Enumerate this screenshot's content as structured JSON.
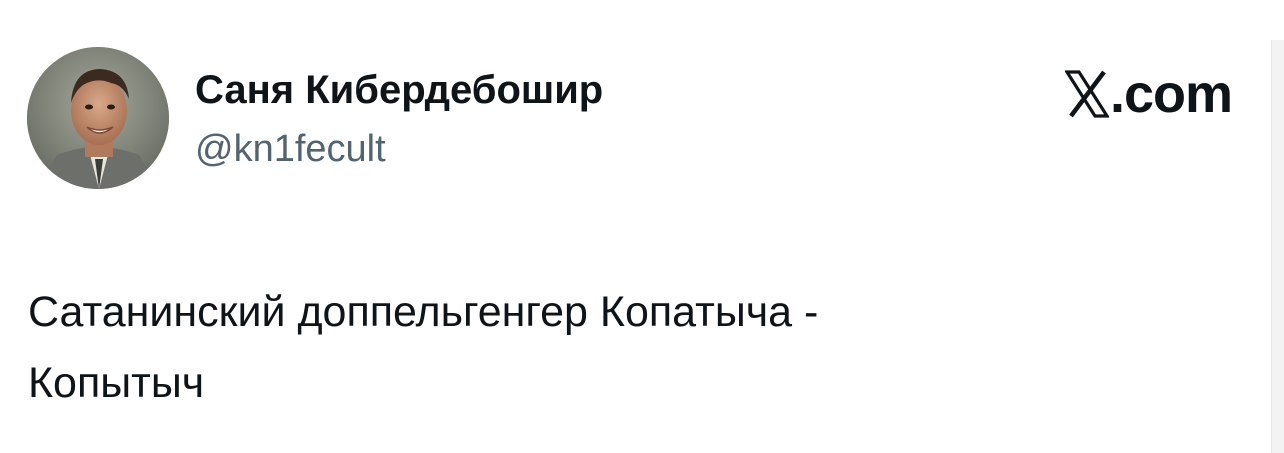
{
  "author": {
    "display_name": "Саня Кибердебошир",
    "handle": "@kn1fecult",
    "avatar_icon": "profile-photo"
  },
  "brand": {
    "icon": "x-logo-icon",
    "domain": ".com"
  },
  "tweet": {
    "lines": [
      "Сатанинский доппельгенгер Копатыча -",
      "Копытыч"
    ]
  },
  "colors": {
    "text_primary": "#0f1419",
    "text_secondary": "#536471",
    "background": "#ffffff"
  }
}
